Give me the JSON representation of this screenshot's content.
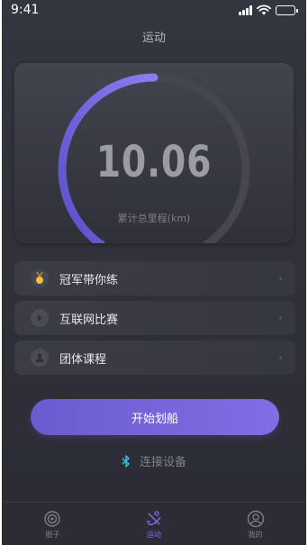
{
  "status_bar": {
    "time": "9:41"
  },
  "header": {
    "title": "运动"
  },
  "gauge": {
    "value": "10.06",
    "label": "累计总里程(km)",
    "fill_fraction": 0.5,
    "colors": {
      "track": "#45464f",
      "arc_start": "#5a4fc9",
      "arc_end": "#8b7cf0"
    }
  },
  "menu": [
    {
      "label": "冠军带你练",
      "icon": "medal-icon"
    },
    {
      "label": "互联网比赛",
      "icon": "play-icon"
    },
    {
      "label": "团体课程",
      "icon": "user-icon"
    }
  ],
  "start_button": {
    "label": "开始划船"
  },
  "connect": {
    "label": "连接设备",
    "icon": "bluetooth-icon"
  },
  "tabs": [
    {
      "label": "圈子",
      "icon": "circle-target-icon",
      "active": false
    },
    {
      "label": "运动",
      "icon": "rowing-icon",
      "active": true
    },
    {
      "label": "我的",
      "icon": "profile-icon",
      "active": false
    }
  ],
  "colors": {
    "accent": "#7f6ee5",
    "background": "#2f3037",
    "bluetooth": "#3fb6e6"
  }
}
